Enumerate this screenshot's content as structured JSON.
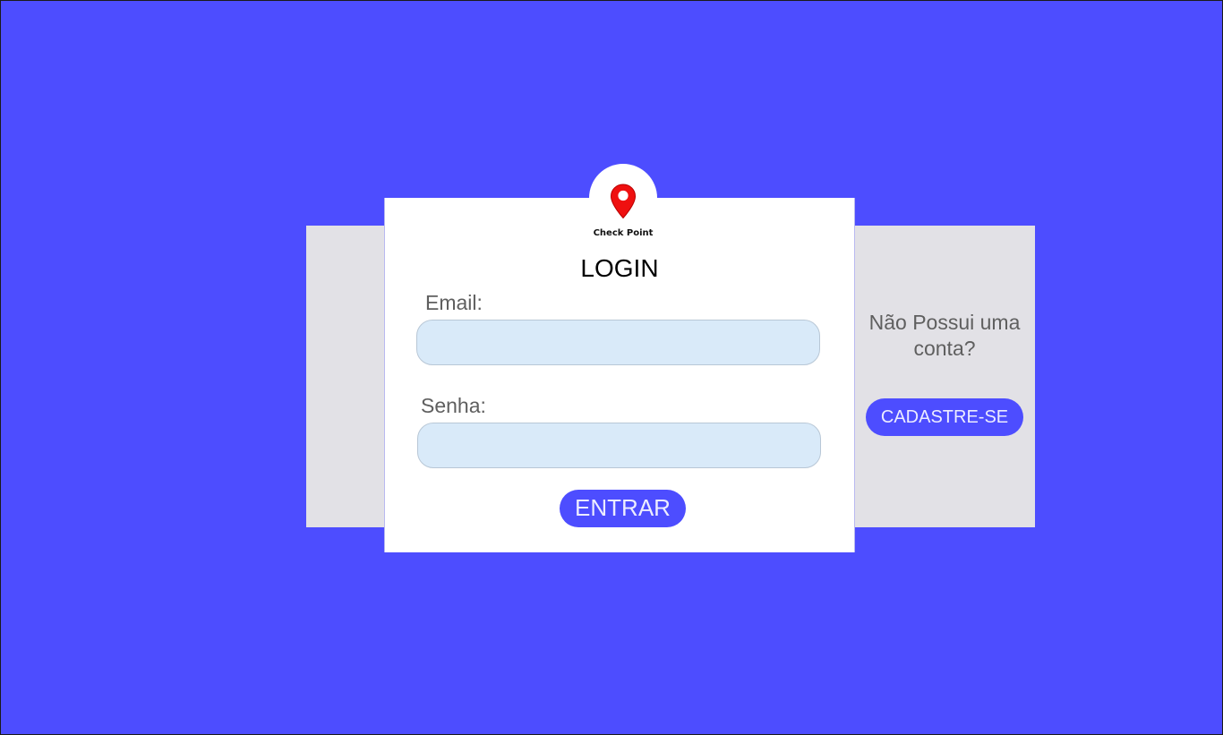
{
  "brand": {
    "name": "Check Point",
    "pin_color": "#ef1010",
    "pin_icon": "map-pin-icon"
  },
  "colors": {
    "background": "#4d4dff",
    "panel": "#e2e1e6",
    "input_fill": "#d9eaf9",
    "button": "#4d4dff"
  },
  "login": {
    "title": "LOGIN",
    "email_label": "Email:",
    "email_value": "",
    "password_label": "Senha:",
    "password_value": "",
    "submit_label": "ENTRAR"
  },
  "signup": {
    "question": "Não Possui uma conta?",
    "button_label": "CADASTRE-SE"
  }
}
